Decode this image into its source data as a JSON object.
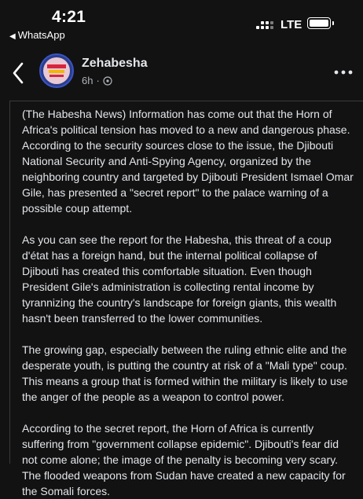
{
  "status_bar": {
    "time": "4:21",
    "back_app": "WhatsApp",
    "network": "LTE",
    "battery_level": 1.0
  },
  "post": {
    "page_name": "Zehabesha",
    "time_ago": "6h",
    "audience_icon": "globe-icon",
    "paragraphs": [
      "(The Habesha News) Information has come out that the Horn of Africa's political tension has moved to a new and dangerous phase. According to the security sources close to the issue, the Djibouti National Security and Anti-Spying Agency, organized by the neighboring country and targeted by Djibouti President Ismael Omar Gile, has presented a \"secret report\" to the palace warning of a possible coup attempt.",
      "As you can see the report for the Habesha, this threat of a coup d'état has a foreign hand, but the internal political collapse of Djibouti has created this comfortable situation. Even though President Gile's administration is collecting rental income by tyrannizing the country's landscape for foreign giants, this wealth hasn't been transferred to the lower communities.",
      "The growing gap, especially between the ruling ethnic elite and the desperate youth, is putting the country at risk of a \"Mali type\" coup. This means a group that is formed within the military is likely to use the anger of the people as a weapon to control power.",
      "According to the secret report, the Horn of Africa is currently suffering from \"government collapse epidemic\". Djibouti's fear did not come alone; the image of the penalty is becoming very scary. The flooded weapons from Sudan have created a new capacity for the Somali forces."
    ]
  },
  "colors": {
    "background": "#121212",
    "text": "#e4e6eb",
    "secondary_text": "#b0b3b8",
    "avatar_ring": "#3a55c4"
  }
}
